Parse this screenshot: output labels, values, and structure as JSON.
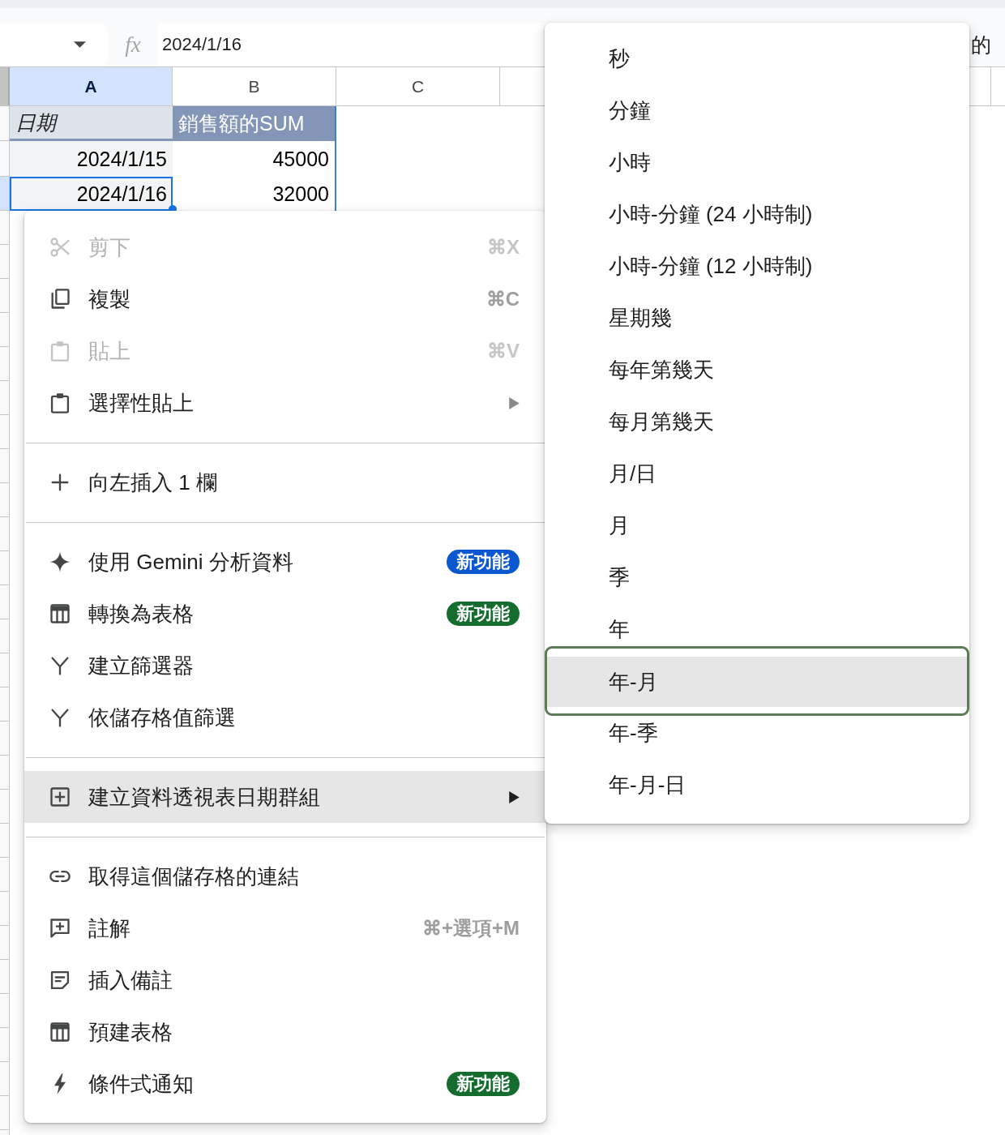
{
  "formula_bar": {
    "label": "fx",
    "value": "2024/1/16"
  },
  "edge_text": "的",
  "sheet": {
    "columns": [
      {
        "label": "A",
        "selected": true
      },
      {
        "label": "B",
        "selected": false
      },
      {
        "label": "C",
        "selected": false
      }
    ],
    "rows": [
      {
        "kind": "header",
        "cells": [
          {
            "text": "日期",
            "selected": false
          },
          {
            "text": "銷售額的SUM",
            "selected": false
          }
        ]
      },
      {
        "kind": "data",
        "cells": [
          {
            "text": "2024/1/15",
            "selected": false
          },
          {
            "text": "45000",
            "selected": false
          }
        ]
      },
      {
        "kind": "data",
        "cells": [
          {
            "text": "2024/1/16",
            "selected": true
          },
          {
            "text": "32000",
            "selected": false
          }
        ]
      }
    ]
  },
  "context_menu": {
    "sections": [
      [
        {
          "kind": "cut",
          "label": "剪下",
          "shortcut": "⌘X",
          "disabled": true,
          "selected": false,
          "submenu": false
        },
        {
          "kind": "copy",
          "label": "複製",
          "shortcut": "⌘C",
          "disabled": false,
          "selected": false,
          "submenu": false
        },
        {
          "kind": "paste",
          "label": "貼上",
          "shortcut": "⌘V",
          "disabled": true,
          "selected": false,
          "submenu": false
        },
        {
          "kind": "special",
          "label": "選擇性貼上",
          "disabled": false,
          "selected": false,
          "submenu": true
        }
      ],
      [
        {
          "kind": "insert",
          "label": "向左插入 1 欄",
          "disabled": false,
          "selected": false,
          "submenu": false
        }
      ],
      [
        {
          "kind": "gemini",
          "label": "使用 Gemini 分析資料",
          "badge": {
            "text": "新功能",
            "color": "#0b57d0"
          },
          "disabled": false,
          "selected": false,
          "submenu": false
        },
        {
          "kind": "convert",
          "label": "轉換為表格",
          "badge": {
            "text": "新功能",
            "color": "#146c2e"
          },
          "disabled": false,
          "selected": false,
          "submenu": false
        },
        {
          "kind": "filter",
          "label": "建立篩選器",
          "disabled": false,
          "selected": false,
          "submenu": false
        },
        {
          "kind": "filtervalue",
          "label": "依儲存格值篩選",
          "disabled": false,
          "selected": false,
          "submenu": false
        }
      ],
      [
        {
          "kind": "group",
          "label": "建立資料透視表日期群組",
          "disabled": false,
          "selected": true,
          "submenu": true
        }
      ],
      [
        {
          "kind": "link",
          "label": "取得這個儲存格的連結",
          "disabled": false,
          "selected": false,
          "submenu": false
        },
        {
          "kind": "comment",
          "label": "註解",
          "shortcut": "⌘+選項+M",
          "disabled": false,
          "selected": false,
          "submenu": false
        },
        {
          "kind": "note",
          "label": "插入備註",
          "disabled": false,
          "selected": false,
          "submenu": false
        },
        {
          "kind": "table",
          "label": "預建表格",
          "disabled": false,
          "selected": false,
          "submenu": false
        },
        {
          "kind": "notify",
          "label": "條件式通知",
          "badge": {
            "text": "新功能",
            "color": "#146c2e"
          },
          "disabled": false,
          "selected": false,
          "submenu": false
        }
      ]
    ]
  },
  "date_group_menu": {
    "items": [
      {
        "label": "秒",
        "selected": false
      },
      {
        "label": "分鐘",
        "selected": false
      },
      {
        "label": "小時",
        "selected": false
      },
      {
        "label": "小時-分鐘 (24 小時制)",
        "selected": false
      },
      {
        "label": "小時-分鐘 (12 小時制)",
        "selected": false
      },
      {
        "label": "星期幾",
        "selected": false
      },
      {
        "label": "每年第幾天",
        "selected": false
      },
      {
        "label": "每月第幾天",
        "selected": false
      },
      {
        "label": "月/日",
        "selected": false
      },
      {
        "label": "月",
        "selected": false
      },
      {
        "label": "季",
        "selected": false
      },
      {
        "label": "年",
        "selected": false
      },
      {
        "label": "年-月",
        "selected": true
      },
      {
        "label": "年-季",
        "selected": false
      },
      {
        "label": "年-月-日",
        "selected": false
      }
    ]
  }
}
